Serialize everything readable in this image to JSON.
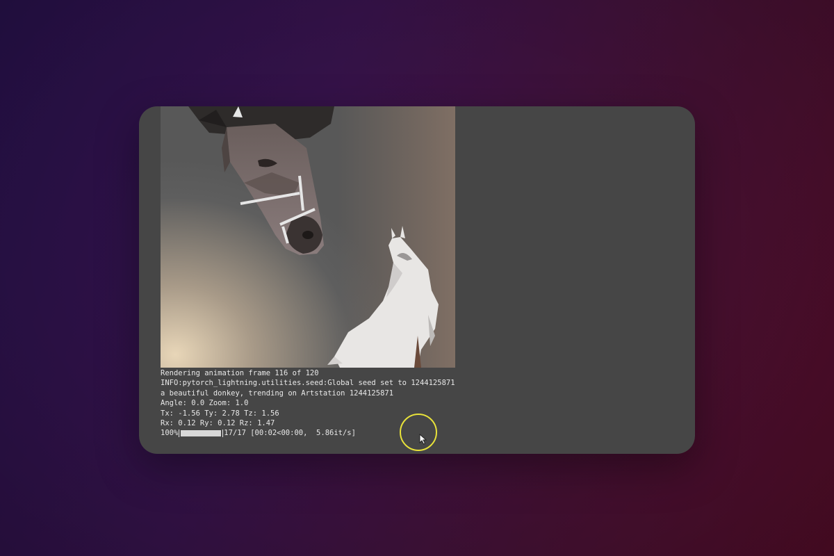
{
  "console": {
    "lines": [
      "Rendering animation frame 116 of 120",
      "INFO:pytorch_lightning.utilities.seed:Global seed set to 1244125871",
      "a beautiful donkey, trending on Artstation 1244125871",
      "Angle: 0.0 Zoom: 1.0",
      "Tx: -1.56 Ty: 2.78 Tz: 1.56",
      "Rx: 0.12 Ry: 0.12 Rz: 1.47"
    ],
    "progress": {
      "percent_label": "100%",
      "fraction": 1.0,
      "count": "17/17",
      "timing": "[00:02<00:00,  5.86it/s]"
    }
  },
  "icons": {
    "cursor": "mouse-pointer-icon",
    "highlight": "cursor-highlight-ring"
  },
  "colors": {
    "card_background": "#464646",
    "console_text": "#e8e8e8",
    "cursor_highlight": "#e8e23a",
    "background_left": "#2a1250",
    "background_right": "#5a0e2c"
  }
}
